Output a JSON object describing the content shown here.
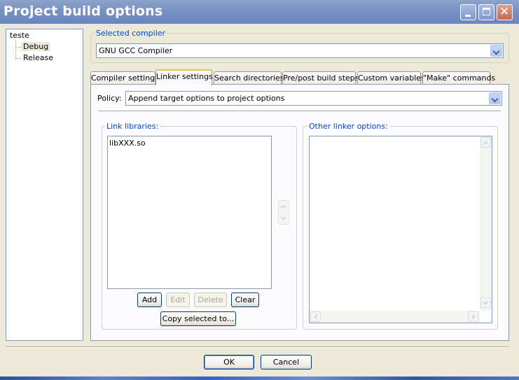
{
  "window": {
    "title": "Project build options"
  },
  "tree": {
    "root": "teste",
    "children": [
      "Debug",
      "Release"
    ],
    "selected": "Debug"
  },
  "compiler": {
    "group_label": "Selected compiler",
    "value": "GNU GCC Compiler"
  },
  "tabs": [
    {
      "label": "Compiler settings",
      "active": false
    },
    {
      "label": "Linker settings",
      "active": true
    },
    {
      "label": "Search directories",
      "active": false
    },
    {
      "label": "Pre/post build steps",
      "active": false
    },
    {
      "label": "Custom variables",
      "active": false
    },
    {
      "label": "\"Make\" commands",
      "active": false
    }
  ],
  "policy": {
    "label": "Policy:",
    "value": "Append target options to project options"
  },
  "link_libraries": {
    "group_label": "Link libraries:",
    "items": [
      "libXXX.so"
    ]
  },
  "other_linker": {
    "group_label": "Other linker options:",
    "value": ""
  },
  "buttons": {
    "add": "Add",
    "edit": "Edit",
    "delete": "Delete",
    "clear": "Clear",
    "copy": "Copy selected to...",
    "ok": "OK",
    "cancel": "Cancel"
  },
  "colors": {
    "title_bar": "#7791c2",
    "group_label": "#0046d5",
    "tab_active_accent": "#f1c04a"
  }
}
